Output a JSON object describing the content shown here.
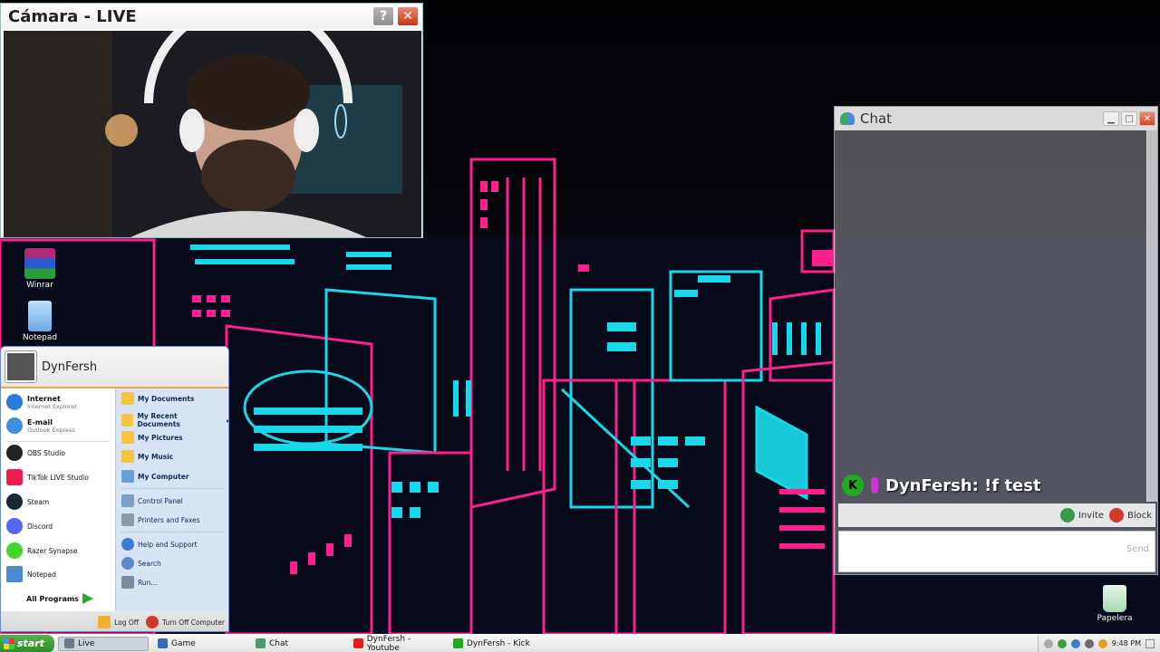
{
  "camera_window": {
    "title": "Cámara - LIVE",
    "help_label": "?",
    "close_label": "✕"
  },
  "desktop_icons": [
    {
      "label": "Winrar",
      "icon": "winrar-icon"
    },
    {
      "label": "Notepad",
      "icon": "notepad-icon"
    },
    {
      "label": "Papelera",
      "icon": "recycle-bin-icon"
    }
  ],
  "chat_window": {
    "title": "Chat",
    "message": {
      "username": "DynFersh",
      "text": "!f test",
      "badge": "K"
    },
    "invite_label": "Invite",
    "block_label": "Block",
    "send_label": "Send"
  },
  "start_menu": {
    "user": "DynFersh",
    "pinned": [
      {
        "title": "Internet",
        "subtitle": "Internet Explorer",
        "icon": "internet-explorer-icon",
        "color": "#2a7ad8"
      },
      {
        "title": "E-mail",
        "subtitle": "Outlook Express",
        "icon": "outlook-express-icon",
        "color": "#3b8ee0"
      }
    ],
    "programs": [
      {
        "label": "OBS Studio",
        "icon": "obs-icon",
        "color": "#222222"
      },
      {
        "label": "TikTok LIVE Studio",
        "icon": "tiktok-icon",
        "color": "#ee1d52"
      },
      {
        "label": "Steam",
        "icon": "steam-icon",
        "color": "#1b2838"
      },
      {
        "label": "Discord",
        "icon": "discord-icon",
        "color": "#5865f2"
      },
      {
        "label": "Razer Synapse",
        "icon": "razer-icon",
        "color": "#44d62c"
      },
      {
        "label": "Notepad",
        "icon": "notepad-icon",
        "color": "#4a8ad4"
      }
    ],
    "all_programs": "All Programs",
    "right_items": [
      {
        "label": "My Documents",
        "bold": true,
        "icon": "folder-icon",
        "color": "#f4c542"
      },
      {
        "label": "My Recent Documents",
        "bold": true,
        "icon": "recent-docs-icon",
        "color": "#f4c542"
      },
      {
        "label": "My Pictures",
        "bold": true,
        "icon": "pictures-icon",
        "color": "#f4c542"
      },
      {
        "label": "My Music",
        "bold": true,
        "icon": "music-icon",
        "color": "#f4c542"
      },
      {
        "label": "My Computer",
        "bold": true,
        "icon": "computer-icon",
        "color": "#6aa0d8"
      },
      {
        "label": "Control Panel",
        "bold": false,
        "icon": "control-panel-icon",
        "color": "#7aa0c8"
      },
      {
        "label": "Printers and Faxes",
        "bold": false,
        "icon": "printer-icon",
        "color": "#8a9ab0"
      },
      {
        "label": "Help and Support",
        "bold": false,
        "icon": "help-icon",
        "color": "#3a7ad8"
      },
      {
        "label": "Search",
        "bold": false,
        "icon": "search-icon",
        "color": "#5a8ac8"
      },
      {
        "label": "Run...",
        "bold": false,
        "icon": "run-icon",
        "color": "#7a8aa0"
      }
    ],
    "log_off": "Log Off",
    "turn_off": "Turn Off Computer"
  },
  "taskbar": {
    "start_label": "start",
    "tasks": [
      {
        "label": "Live",
        "active": true,
        "icon": "window-icon",
        "color": "#6a7a8a"
      },
      {
        "label": "Game",
        "active": false,
        "icon": "game-icon",
        "color": "#3a6ab8"
      },
      {
        "label": "Chat",
        "active": false,
        "icon": "chat-icon",
        "color": "#4a9a6a"
      },
      {
        "label": "DynFersh - Youtube",
        "active": false,
        "icon": "youtube-icon",
        "color": "#e22020"
      },
      {
        "label": "DynFersh - Kick",
        "active": false,
        "icon": "kick-icon",
        "color": "#22aa22"
      }
    ],
    "clock": "9:48 PM"
  }
}
